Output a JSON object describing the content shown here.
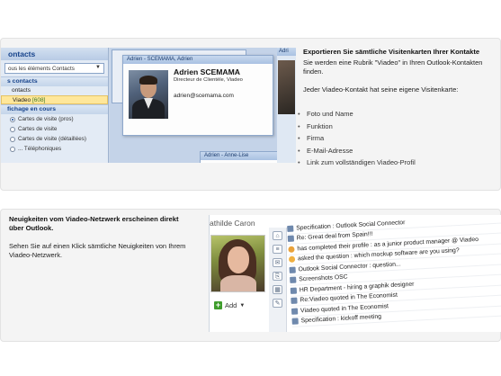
{
  "section1": {
    "title": "Exportieren Sie sämtliche Visitenkarten Ihrer Kontakte",
    "intro": "Sie werden eine Rubrik \"Viadeo\" in Ihren Outlook-Kontakten finden.",
    "lead": "Jeder Viadeo-Kontakt hat seine eigene Visitenkarte:",
    "bullets": [
      "Foto und Name",
      "Funktion",
      "Firma",
      "E-Mail-Adresse",
      "Link zum vollständigen Viadeo-Profil"
    ],
    "screenshot": {
      "nav_title": "ontacts",
      "nav_select": "ous les éléments Contacts",
      "nav_section_contacts": "s contacts",
      "nav_items": [
        {
          "label": "ontacts",
          "count": ""
        },
        {
          "label": "Viadeo",
          "count": "[608]"
        }
      ],
      "nav_section_view": "fichage en cours",
      "view_options": [
        "Cartes de visite (pros)",
        "Cartes de visite",
        "Cartes de visite (détaillées)",
        "... Téléphoniques"
      ],
      "card_header": "Adrien - SCEMAMA, Adrien",
      "card_name": "Adrien SCEMAMA",
      "card_role": "Directeur de Clientèle, Viadeo",
      "card_email": "adrien@scemama.com",
      "bottom_card_header": "Adrien - Anne-Lise",
      "side_header": "Adri"
    }
  },
  "section2": {
    "title": "Neuigkeiten vom Viadeo-Netzwerk erscheinen direkt über Outlook.",
    "body": "Sehen Sie auf einen Klick sämtliche Neuigkeiten von Ihrem Viadeo-Netzwerk.",
    "screenshot": {
      "person_name": "athilde Caron",
      "add_label": "Add",
      "feed": [
        {
          "icon": "b",
          "text": "Specification : Outlook Social Connector"
        },
        {
          "icon": "b",
          "text": "Re: Great deal from Spain!!!"
        },
        {
          "icon": "g",
          "text": "has completed their profile : as a junior product manager @ Viadeo"
        },
        {
          "icon": "o",
          "text": "asked the question : which mockup software are you using?"
        },
        {
          "icon": "b",
          "text": "Outlook Social Connector : question..."
        },
        {
          "icon": "b",
          "text": "Screenshots OSC"
        },
        {
          "icon": "b",
          "text": "HR Department - hiring a graphik designer"
        },
        {
          "icon": "b",
          "text": "Re:Viadeo quoted in The Economist"
        },
        {
          "icon": "b",
          "text": "Viadeo quoted in The Economist"
        },
        {
          "icon": "b",
          "text": "Specification : kickoff meeting"
        }
      ]
    }
  },
  "icons": {
    "radio": "radio-icon",
    "photo": "contact-photo",
    "add": "plus-icon",
    "feed_item": "feed-item-icon"
  },
  "colors": {
    "outlook_blue": "#c9d6e8",
    "nav_title_text": "#15428b",
    "add_green": "#3f9d2c"
  }
}
